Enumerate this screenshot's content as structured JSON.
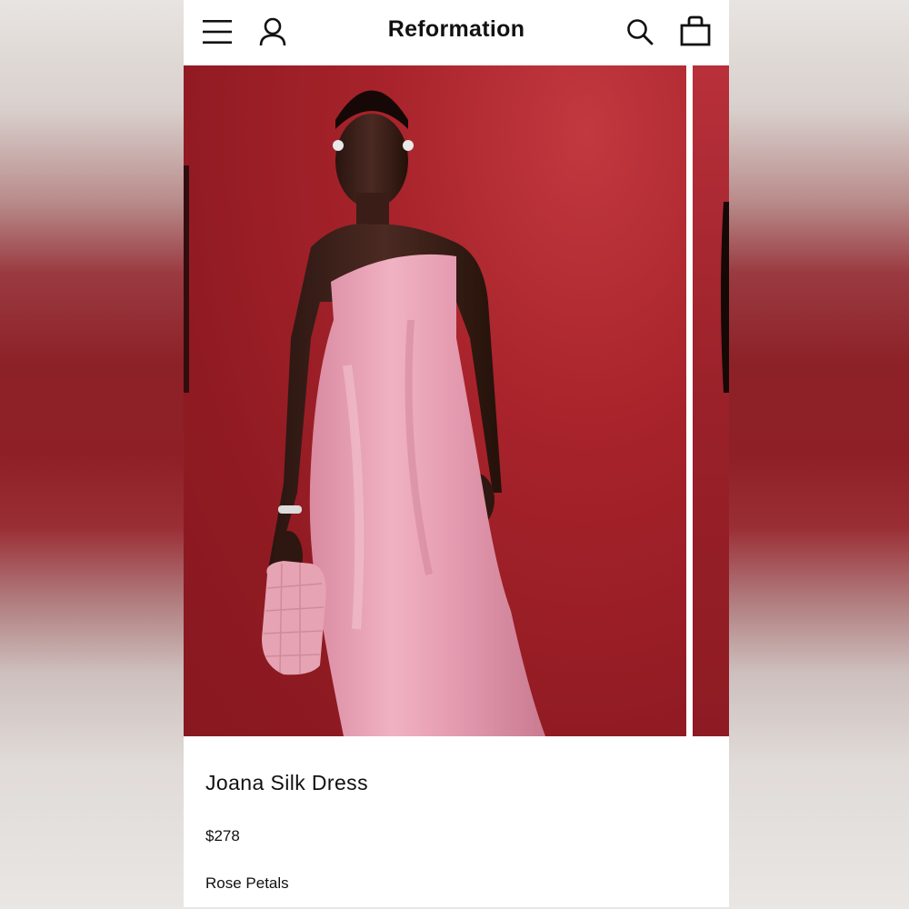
{
  "header": {
    "brand": "Reformation",
    "icons": [
      "menu-icon",
      "account-icon",
      "search-icon",
      "bag-icon"
    ]
  },
  "product": {
    "name": "Joana Silk Dress",
    "price": "$278",
    "color": "Rose Petals"
  },
  "colors": {
    "backdrop_red": "#a8232b",
    "dress_pink": "#e8a0b2",
    "text": "#111111"
  }
}
